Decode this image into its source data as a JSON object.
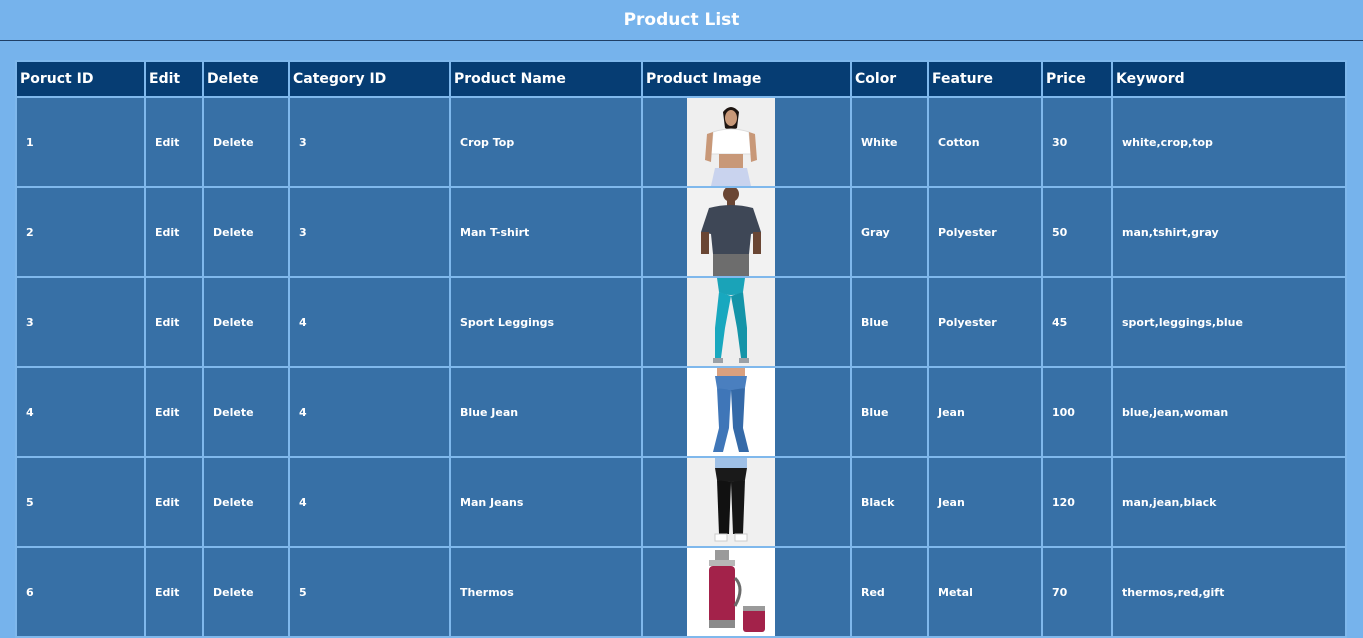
{
  "header": {
    "title": "Product List"
  },
  "table": {
    "columns": [
      "Poruct ID",
      "Edit",
      "Delete",
      "Category ID",
      "Product Name",
      "Product Image",
      "Color",
      "Feature",
      "Price",
      "Keyword"
    ],
    "rows": [
      {
        "id": "1",
        "edit": "Edit",
        "delete": "Delete",
        "category_id": "3",
        "name": "Crop Top",
        "image": "crop-top-photo",
        "color": "White",
        "feature": "Cotton",
        "price": "30",
        "keyword": "white,crop,top"
      },
      {
        "id": "2",
        "edit": "Edit",
        "delete": "Delete",
        "category_id": "3",
        "name": "Man T-shirt",
        "image": "man-tshirt-photo",
        "color": "Gray",
        "feature": "Polyester",
        "price": "50",
        "keyword": "man,tshirt,gray"
      },
      {
        "id": "3",
        "edit": "Edit",
        "delete": "Delete",
        "category_id": "4",
        "name": "Sport Leggings",
        "image": "sport-leggings-photo",
        "color": "Blue",
        "feature": "Polyester",
        "price": "45",
        "keyword": "sport,leggings,blue"
      },
      {
        "id": "4",
        "edit": "Edit",
        "delete": "Delete",
        "category_id": "4",
        "name": "Blue Jean",
        "image": "blue-jean-photo",
        "color": "Blue",
        "feature": "Jean",
        "price": "100",
        "keyword": "blue,jean,woman"
      },
      {
        "id": "5",
        "edit": "Edit",
        "delete": "Delete",
        "category_id": "4",
        "name": "Man Jeans",
        "image": "man-jeans-photo",
        "color": "Black",
        "feature": "Jean",
        "price": "120",
        "keyword": "man,jean,black"
      },
      {
        "id": "6",
        "edit": "Edit",
        "delete": "Delete",
        "category_id": "5",
        "name": "Thermos",
        "image": "thermos-photo",
        "color": "Red",
        "feature": "Metal",
        "price": "70",
        "keyword": "thermos,red,gift"
      }
    ]
  },
  "colors": {
    "page_bg": "#76b3ec",
    "header_cell_bg": "#063d73",
    "body_cell_bg": "#3770a6",
    "cell_border": "#7fb8ec"
  }
}
